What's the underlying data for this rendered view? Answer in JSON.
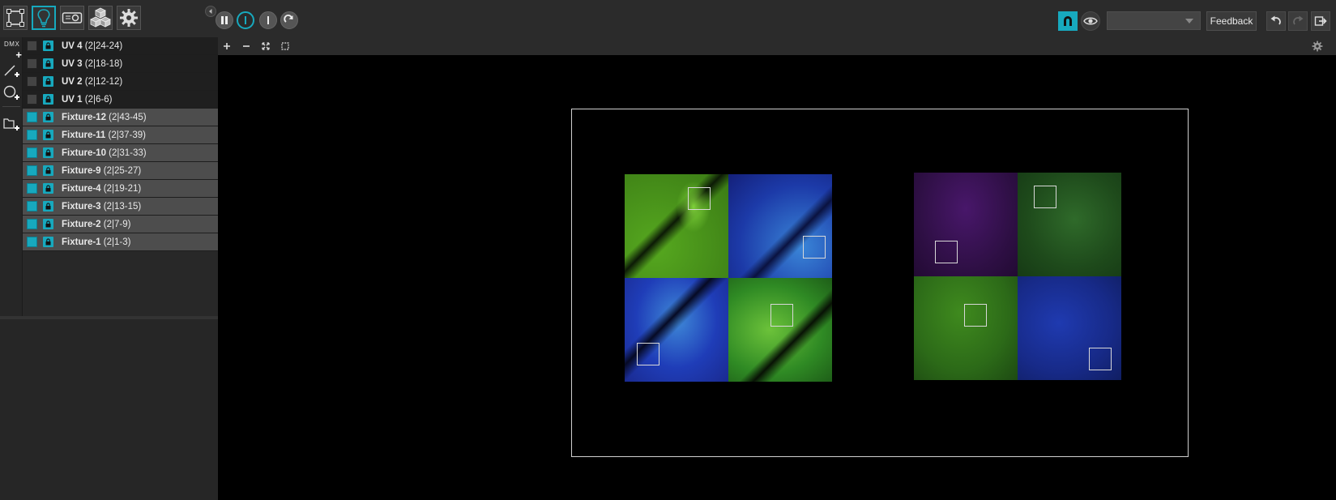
{
  "toolbar": {
    "modes": [
      {
        "name": "patch-mode-icon",
        "active": false
      },
      {
        "name": "fixture-mode-icon",
        "active": true
      },
      {
        "name": "projector-mode-icon",
        "active": false
      },
      {
        "name": "objects-mode-icon",
        "active": false
      },
      {
        "name": "settings-mode-icon",
        "active": false
      }
    ],
    "playback": [
      "pause-icon",
      "blackout-icon",
      "freeze-icon",
      "redo-icon"
    ],
    "view_select_value": "",
    "feedback_label": "Feedback"
  },
  "left_tools": {
    "dmx_label": "DMX",
    "tools": [
      "add-dmx-icon",
      "add-line-icon",
      "add-circle-icon",
      "add-folder-icon"
    ]
  },
  "fixtures": [
    {
      "name": "UV 4",
      "address": "(2|24-24)",
      "selected": false
    },
    {
      "name": "UV 3",
      "address": "(2|18-18)",
      "selected": false
    },
    {
      "name": "UV 2",
      "address": "(2|12-12)",
      "selected": false
    },
    {
      "name": "UV 1",
      "address": "(2|6-6)",
      "selected": false
    },
    {
      "name": "Fixture-12",
      "address": "(2|43-45)",
      "selected": true
    },
    {
      "name": "Fixture-11",
      "address": "(2|37-39)",
      "selected": true
    },
    {
      "name": "Fixture-10",
      "address": "(2|31-33)",
      "selected": true
    },
    {
      "name": "Fixture-9",
      "address": "(2|25-27)",
      "selected": true
    },
    {
      "name": "Fixture-4",
      "address": "(2|19-21)",
      "selected": true
    },
    {
      "name": "Fixture-3",
      "address": "(2|13-15)",
      "selected": true
    },
    {
      "name": "Fixture-2",
      "address": "(2|7-9)",
      "selected": true
    },
    {
      "name": "Fixture-1",
      "address": "(2|1-3)",
      "selected": true
    }
  ],
  "canvas_tools": [
    "zoom-in-icon",
    "zoom-out-icon",
    "fit-icon",
    "select-area-icon"
  ],
  "colors": {
    "accent": "#17a9be",
    "green": "#3f9a1e",
    "blue": "#1f3db8",
    "purple": "#3a1250",
    "dark_green": "#1f4d1c",
    "dark_blue": "#16237a"
  }
}
